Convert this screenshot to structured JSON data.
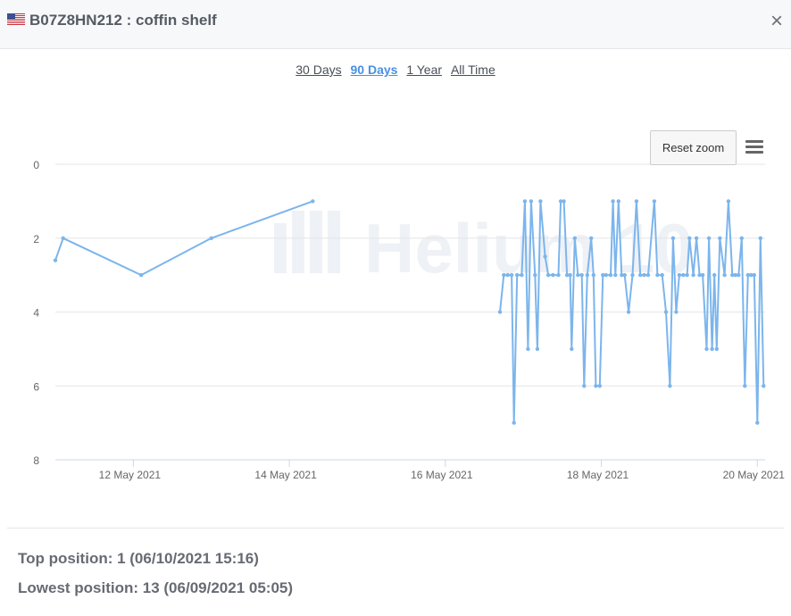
{
  "header": {
    "title": "B07Z8HN212 : coffin shelf",
    "flag_icon": "us-flag-icon",
    "close_icon": "close-icon"
  },
  "ranges": [
    {
      "label": "30 Days",
      "active": false
    },
    {
      "label": "90 Days",
      "active": true
    },
    {
      "label": "1 Year",
      "active": false
    },
    {
      "label": "All Time",
      "active": false
    }
  ],
  "toolbar": {
    "reset_zoom_label": "Reset zoom",
    "menu_icon": "hamburger-menu-icon"
  },
  "watermark": "Helium 10",
  "colors": {
    "series": "#7cb5ec",
    "active_range": "#4a90e2"
  },
  "chart_data": {
    "type": "line",
    "y_reversed": true,
    "ylim": [
      0,
      8
    ],
    "y_ticks": [
      "0",
      "2",
      "4",
      "6",
      "8"
    ],
    "x_ticks": [
      {
        "label": "12 May 2021",
        "day": 12
      },
      {
        "label": "14 May 2021",
        "day": 14
      },
      {
        "label": "16 May 2021",
        "day": 16
      },
      {
        "label": "18 May 2021",
        "day": 18
      },
      {
        "label": "20 May 2021",
        "day": 20
      }
    ],
    "x_range_days": [
      11.0,
      20.1
    ],
    "series": [
      {
        "points": [
          [
            11.0,
            2.6
          ],
          [
            11.1,
            2.0
          ],
          [
            12.1,
            3.0
          ],
          [
            13.0,
            2.0
          ],
          [
            14.3,
            1.0
          ],
          null,
          [
            16.7,
            4.0
          ],
          [
            16.75,
            3.0
          ],
          [
            16.8,
            3.0
          ],
          [
            16.85,
            3.0
          ],
          [
            16.88,
            7.0
          ],
          [
            16.92,
            3.0
          ],
          [
            16.98,
            3.0
          ],
          [
            17.02,
            1.0
          ],
          [
            17.06,
            5.0
          ],
          [
            17.1,
            1.0
          ],
          [
            17.15,
            3.0
          ],
          [
            17.18,
            5.0
          ],
          [
            17.22,
            1.0
          ],
          [
            17.28,
            2.5
          ],
          [
            17.32,
            3.0
          ],
          [
            17.38,
            3.0
          ],
          [
            17.45,
            3.0
          ],
          [
            17.48,
            1.0
          ],
          [
            17.52,
            1.0
          ],
          [
            17.56,
            3.0
          ],
          [
            17.6,
            3.0
          ],
          [
            17.62,
            5.0
          ],
          [
            17.66,
            2.0
          ],
          [
            17.7,
            3.0
          ],
          [
            17.75,
            3.0
          ],
          [
            17.78,
            6.0
          ],
          [
            17.82,
            3.0
          ],
          [
            17.87,
            2.0
          ],
          [
            17.9,
            3.0
          ],
          [
            17.93,
            6.0
          ],
          [
            17.98,
            6.0
          ],
          [
            18.02,
            3.0
          ],
          [
            18.06,
            3.0
          ],
          [
            18.12,
            3.0
          ],
          [
            18.15,
            1.0
          ],
          [
            18.18,
            3.0
          ],
          [
            18.22,
            1.0
          ],
          [
            18.26,
            3.0
          ],
          [
            18.3,
            3.0
          ],
          [
            18.35,
            4.0
          ],
          [
            18.4,
            3.0
          ],
          [
            18.45,
            1.0
          ],
          [
            18.5,
            3.0
          ],
          [
            18.55,
            3.0
          ],
          [
            18.6,
            3.0
          ],
          [
            18.68,
            1.0
          ],
          [
            18.72,
            3.0
          ],
          [
            18.78,
            3.0
          ],
          [
            18.83,
            4.0
          ],
          [
            18.88,
            6.0
          ],
          [
            18.92,
            2.0
          ],
          [
            18.96,
            4.0
          ],
          [
            19.0,
            3.0
          ],
          [
            19.05,
            3.0
          ],
          [
            19.1,
            3.0
          ],
          [
            19.13,
            2.0
          ],
          [
            19.18,
            3.0
          ],
          [
            19.22,
            2.0
          ],
          [
            19.26,
            3.0
          ],
          [
            19.3,
            3.0
          ],
          [
            19.35,
            5.0
          ],
          [
            19.38,
            2.0
          ],
          [
            19.42,
            5.0
          ],
          [
            19.45,
            3.0
          ],
          [
            19.48,
            5.0
          ],
          [
            19.52,
            2.0
          ],
          [
            19.58,
            3.0
          ],
          [
            19.63,
            1.0
          ],
          [
            19.68,
            3.0
          ],
          [
            19.72,
            3.0
          ],
          [
            19.76,
            3.0
          ],
          [
            19.8,
            2.0
          ],
          [
            19.84,
            6.0
          ],
          [
            19.88,
            3.0
          ],
          [
            19.92,
            3.0
          ],
          [
            19.96,
            3.0
          ],
          [
            20.0,
            7.0
          ],
          [
            20.04,
            2.0
          ],
          [
            20.08,
            6.0
          ]
        ]
      }
    ]
  },
  "stats": {
    "top": "Top position: 1 (06/10/2021 15:16)",
    "lowest": "Lowest position: 13 (06/09/2021 05:05)"
  }
}
